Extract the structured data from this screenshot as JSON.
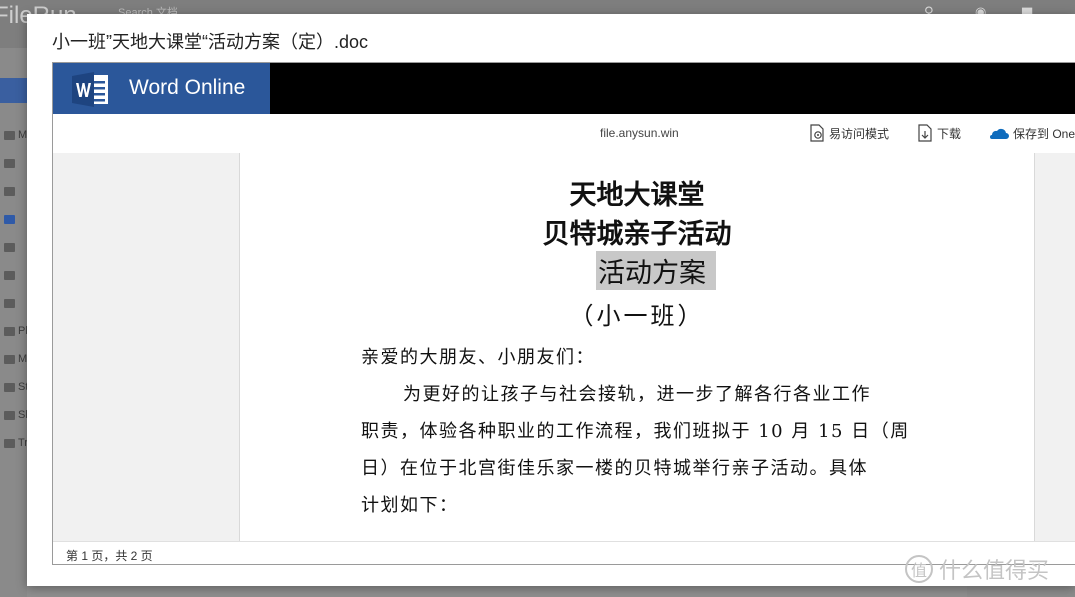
{
  "background": {
    "app_name": "FileRun",
    "search_placeholder": "Search 文档",
    "sidebar_items": [
      {
        "label": "My",
        "icon": "folder-icon"
      },
      {
        "label": "",
        "icon": "folder-icon"
      },
      {
        "label": "",
        "icon": "folder-icon"
      },
      {
        "label": "",
        "icon": "folder-icon"
      },
      {
        "label": "",
        "icon": "folder-icon"
      },
      {
        "label": "",
        "icon": "folder-icon"
      },
      {
        "label": "",
        "icon": "folder-icon"
      },
      {
        "label": "Ph",
        "icon": "photos-icon"
      },
      {
        "label": "Mu",
        "icon": "music-icon"
      },
      {
        "label": "St",
        "icon": "star-icon"
      },
      {
        "label": "Sh",
        "icon": "share-icon"
      },
      {
        "label": "Tr",
        "icon": "trash-icon"
      }
    ]
  },
  "modal": {
    "title": "小一班”天地大课堂“活动方案（定）.doc"
  },
  "word_online": {
    "brand": "Word Online",
    "domain": "file.anysun.win",
    "tools": {
      "accessibility": "易访问模式",
      "download": "下载",
      "save_onedrive": "保存到 One"
    }
  },
  "document": {
    "title_line1": "天地大课堂",
    "title_line2": "贝特城亲子活动",
    "title_line3": "活动方案",
    "title_line4": "（小一班）",
    "greeting": "亲爱的大朋友、小朋友们：",
    "paragraph_lines": [
      "为更好的让孩子与社会接轨，进一步了解各行各业工作",
      "职责，体验各种职业的工作流程，我们班拟于 10 月 15 日（周",
      "日）在位于北宫街佳乐家一楼的贝特城举行亲子活动。具体",
      "计划如下："
    ]
  },
  "status": {
    "page_info": "第 1 页，共 2 页"
  },
  "watermark": {
    "icon_char": "值",
    "text": "什么值得买"
  }
}
